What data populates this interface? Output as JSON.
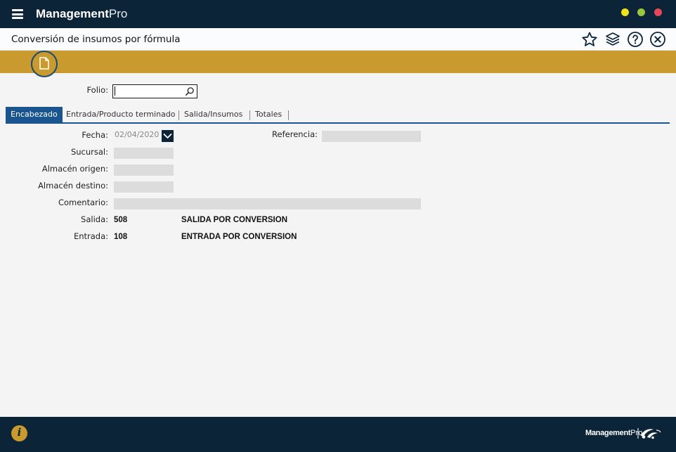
{
  "app": {
    "title_bold": "Management",
    "title_regular": "Pro"
  },
  "page": {
    "title": "Conversión de insumos por fórmula",
    "icons": [
      "star-icon",
      "layers-icon",
      "help-icon",
      "close-icon"
    ]
  },
  "toolbar": {
    "new_icon": "new-document-icon"
  },
  "folio": {
    "label": "Folio:",
    "value": "",
    "search_icon": "search-icon"
  },
  "tabs": [
    {
      "label": "Encabezado",
      "active": true
    },
    {
      "label": "Entrada/Producto terminado",
      "active": false
    },
    {
      "label": "Salida/Insumos",
      "active": false
    },
    {
      "label": "Totales",
      "active": false
    }
  ],
  "form": {
    "fecha_label": "Fecha:",
    "fecha_value": "02/04/2020",
    "referencia_label": "Referencia:",
    "sucursal_label": "Sucursal:",
    "almacen_origen_label": "Almacén origen:",
    "almacen_destino_label": "Almacén destino:",
    "comentario_label": "Comentario:",
    "salida_label": "Salida:",
    "salida_code": "508",
    "salida_desc": "SALIDA POR CONVERSION",
    "entrada_label": "Entrada:",
    "entrada_code": "108",
    "entrada_desc": "ENTRADA POR CONVERSION"
  },
  "footer": {
    "info_icon": "info-icon",
    "brand_bold": "Management",
    "brand_regular": "Pro"
  },
  "colors": {
    "navy": "#0c2438",
    "gold": "#c99a2e",
    "tab_blue": "#1a5590"
  }
}
